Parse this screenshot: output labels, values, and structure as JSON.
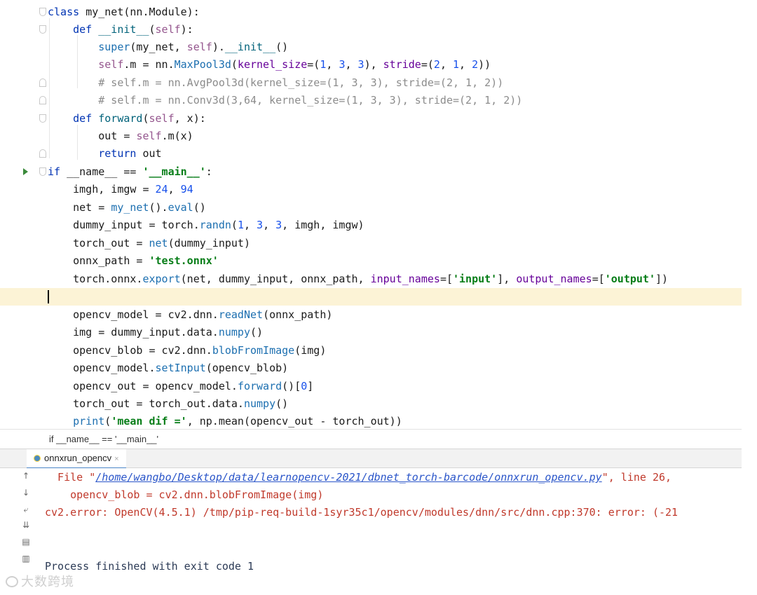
{
  "editor": {
    "lines": [
      {
        "tokens": [
          [
            "kw",
            "class "
          ],
          [
            "plain",
            "my_net(nn.Module):"
          ]
        ]
      },
      {
        "tokens": [
          [
            "plain",
            "    "
          ],
          [
            "kw",
            "def "
          ],
          [
            "fn",
            "__init__"
          ],
          [
            "plain",
            "("
          ],
          [
            "self",
            "self"
          ],
          [
            "plain",
            "):"
          ]
        ]
      },
      {
        "tokens": [
          [
            "plain",
            "        "
          ],
          [
            "call",
            "super"
          ],
          [
            "plain",
            "(my_net, "
          ],
          [
            "self",
            "self"
          ],
          [
            "plain",
            ")."
          ],
          [
            "fn",
            "__init__"
          ],
          [
            "plain",
            "()"
          ]
        ]
      },
      {
        "tokens": [
          [
            "plain",
            "        "
          ],
          [
            "self",
            "self"
          ],
          [
            "plain",
            ".m = nn."
          ],
          [
            "call",
            "MaxPool3d"
          ],
          [
            "plain",
            "("
          ],
          [
            "kwarg",
            "kernel_size"
          ],
          [
            "plain",
            "=("
          ],
          [
            "num",
            "1"
          ],
          [
            "plain",
            ", "
          ],
          [
            "num",
            "3"
          ],
          [
            "plain",
            ", "
          ],
          [
            "num",
            "3"
          ],
          [
            "plain",
            "), "
          ],
          [
            "kwarg",
            "stride"
          ],
          [
            "plain",
            "=("
          ],
          [
            "num",
            "2"
          ],
          [
            "plain",
            ", "
          ],
          [
            "num",
            "1"
          ],
          [
            "plain",
            ", "
          ],
          [
            "num",
            "2"
          ],
          [
            "plain",
            "))"
          ]
        ]
      },
      {
        "tokens": [
          [
            "plain",
            "        "
          ],
          [
            "cmt",
            "# self.m = nn.AvgPool3d(kernel_size=(1, 3, 3), stride=(2, 1, 2))"
          ]
        ]
      },
      {
        "tokens": [
          [
            "plain",
            "        "
          ],
          [
            "cmt",
            "# self.m = nn.Conv3d(3,64, kernel_size=(1, 3, 3), stride=(2, 1, 2))"
          ]
        ]
      },
      {
        "tokens": [
          [
            "plain",
            "    "
          ],
          [
            "kw",
            "def "
          ],
          [
            "fn",
            "forward"
          ],
          [
            "plain",
            "("
          ],
          [
            "self",
            "self"
          ],
          [
            "plain",
            ", x):"
          ]
        ]
      },
      {
        "tokens": [
          [
            "plain",
            "        out = "
          ],
          [
            "self",
            "self"
          ],
          [
            "plain",
            ".m(x)"
          ]
        ]
      },
      {
        "tokens": [
          [
            "plain",
            "        "
          ],
          [
            "kw",
            "return"
          ],
          [
            "plain",
            " out"
          ]
        ]
      },
      {
        "tokens": [
          [
            "kw",
            "if "
          ],
          [
            "plain",
            "__name__ == "
          ],
          [
            "str",
            "'__main__'"
          ],
          [
            "plain",
            ":"
          ]
        ]
      },
      {
        "tokens": [
          [
            "plain",
            "    imgh, imgw = "
          ],
          [
            "num",
            "24"
          ],
          [
            "plain",
            ", "
          ],
          [
            "num",
            "94"
          ]
        ]
      },
      {
        "tokens": [
          [
            "plain",
            "    net = "
          ],
          [
            "call",
            "my_net"
          ],
          [
            "plain",
            "()."
          ],
          [
            "call",
            "eval"
          ],
          [
            "plain",
            "()"
          ]
        ]
      },
      {
        "tokens": [
          [
            "plain",
            "    dummy_input = torch."
          ],
          [
            "call",
            "randn"
          ],
          [
            "plain",
            "("
          ],
          [
            "num",
            "1"
          ],
          [
            "plain",
            ", "
          ],
          [
            "num",
            "3"
          ],
          [
            "plain",
            ", "
          ],
          [
            "num",
            "3"
          ],
          [
            "plain",
            ", imgh, imgw)"
          ]
        ]
      },
      {
        "tokens": [
          [
            "plain",
            "    torch_out = "
          ],
          [
            "call",
            "net"
          ],
          [
            "plain",
            "(dummy_input)"
          ]
        ]
      },
      {
        "tokens": [
          [
            "plain",
            "    onnx_path = "
          ],
          [
            "str",
            "'test.onnx'"
          ]
        ]
      },
      {
        "tokens": [
          [
            "plain",
            "    torch.onnx."
          ],
          [
            "call",
            "export"
          ],
          [
            "plain",
            "(net, dummy_input, onnx_path, "
          ],
          [
            "kwarg",
            "input_names"
          ],
          [
            "plain",
            "=["
          ],
          [
            "str",
            "'input'"
          ],
          [
            "plain",
            "], "
          ],
          [
            "kwarg",
            "output_names"
          ],
          [
            "plain",
            "=["
          ],
          [
            "str",
            "'output'"
          ],
          [
            "plain",
            "])"
          ]
        ]
      },
      {
        "tokens": [
          [
            "plain",
            ""
          ]
        ]
      },
      {
        "tokens": [
          [
            "plain",
            "    opencv_model = cv2.dnn."
          ],
          [
            "call",
            "readNet"
          ],
          [
            "plain",
            "(onnx_path)"
          ]
        ]
      },
      {
        "tokens": [
          [
            "plain",
            "    img = dummy_input.data."
          ],
          [
            "call",
            "numpy"
          ],
          [
            "plain",
            "()"
          ]
        ]
      },
      {
        "tokens": [
          [
            "plain",
            "    opencv_blob = cv2.dnn."
          ],
          [
            "call",
            "blobFromImage"
          ],
          [
            "plain",
            "(img)"
          ]
        ]
      },
      {
        "tokens": [
          [
            "plain",
            "    opencv_model."
          ],
          [
            "call",
            "setInput"
          ],
          [
            "plain",
            "(opencv_blob)"
          ]
        ]
      },
      {
        "tokens": [
          [
            "plain",
            "    opencv_out = opencv_model."
          ],
          [
            "call",
            "forward"
          ],
          [
            "plain",
            "()["
          ],
          [
            "num",
            "0"
          ],
          [
            "plain",
            "]"
          ]
        ]
      },
      {
        "tokens": [
          [
            "plain",
            "    torch_out = torch_out.data."
          ],
          [
            "call",
            "numpy"
          ],
          [
            "plain",
            "()"
          ]
        ]
      },
      {
        "tokens": [
          [
            "plain",
            "    "
          ],
          [
            "call",
            "print"
          ],
          [
            "plain",
            "("
          ],
          [
            "str",
            "'mean dif ='"
          ],
          [
            "plain",
            ", np.mean(opencv_out - torch_out))"
          ]
        ]
      }
    ]
  },
  "breadcrumb": {
    "text": "if __name__ == '__main__'"
  },
  "run_tab": {
    "label": "onnxrun_opencv",
    "close": "×"
  },
  "console": {
    "file_prefix": "  File \"",
    "file_path": "/home/wangbo/Desktop/data/learnopencv-2021/dbnet_torch-barcode/onnxrun_opencv.py",
    "file_suffix": "\", line 26,",
    "code_line": "    opencv_blob = cv2.dnn.blobFromImage(img)",
    "error_line": "cv2.error: OpenCV(4.5.1) /tmp/pip-req-build-1syr35c1/opencv/modules/dnn/src/dnn.cpp:370: error: (-21",
    "finish_line": "Process finished with exit code 1"
  },
  "watermark": {
    "text": "大数跨境"
  },
  "icons": [
    "fold-marker-icon",
    "run-arrow-icon",
    "scroll-up-icon",
    "scroll-down-icon",
    "soft-wrap-icon",
    "scroll-to-end-icon",
    "print-icon",
    "trash-icon",
    "python-file-icon"
  ]
}
